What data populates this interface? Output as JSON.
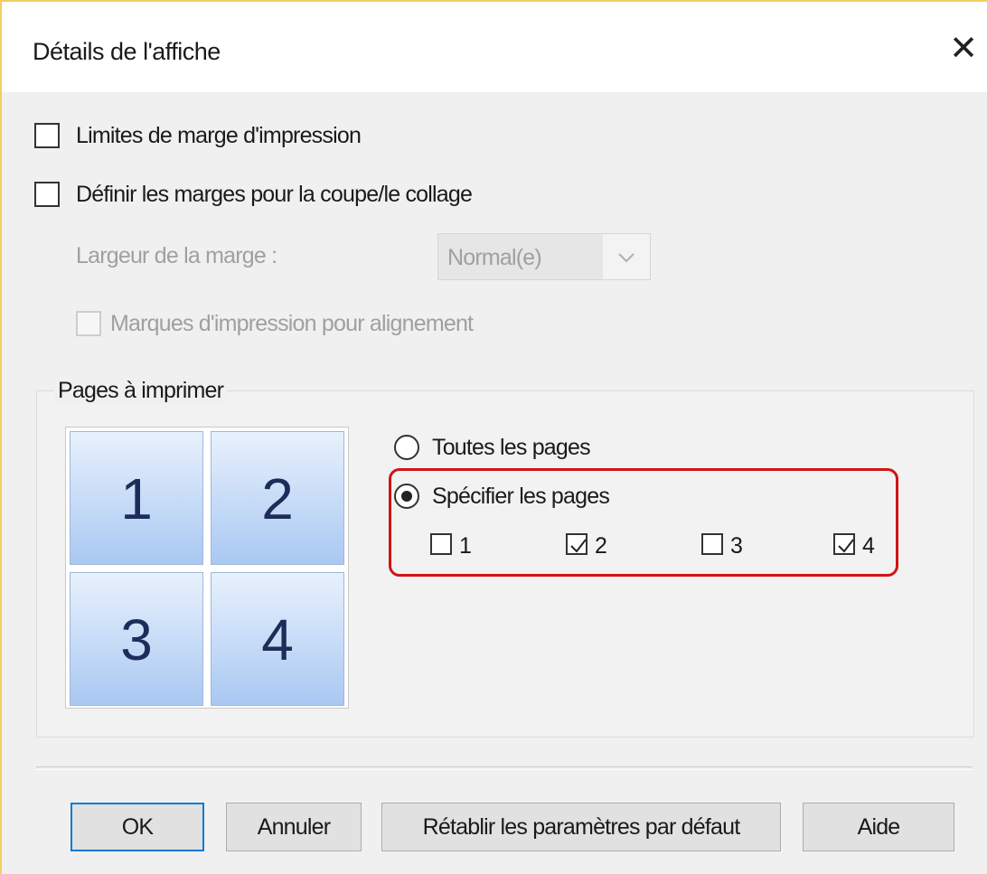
{
  "dialog": {
    "title": "Détails de l'affiche",
    "close_glyph": "✕"
  },
  "options": {
    "print_margin_limits": {
      "label": "Limites de marge d'impression",
      "checked": false
    },
    "set_cut_paste_margins": {
      "label": "Définir les marges pour la coupe/le collage",
      "checked": false
    },
    "margin_width": {
      "label": "Largeur de la marge :",
      "value": "Normal(e)",
      "enabled": false
    },
    "alignment_marks": {
      "label": "Marques d'impression pour alignement",
      "checked": false,
      "enabled": false
    }
  },
  "pages_group": {
    "title": "Pages à imprimer",
    "tiles": [
      "1",
      "2",
      "3",
      "4"
    ],
    "all_pages_label": "Toutes les pages",
    "specify_pages_label": "Spécifier les pages",
    "selected_mode": "specify",
    "page_checkboxes": [
      {
        "label": "1",
        "checked": false
      },
      {
        "label": "2",
        "checked": true
      },
      {
        "label": "3",
        "checked": false
      },
      {
        "label": "4",
        "checked": true
      }
    ]
  },
  "buttons": {
    "ok": "OK",
    "cancel": "Annuler",
    "reset": "Rétablir les paramètres par défaut",
    "help": "Aide"
  },
  "colors": {
    "highlight": "#d11414",
    "default_button_border": "#0a78d7",
    "tile_gradient_top": "#e8f1fd",
    "tile_gradient_bottom": "#a9c8f2"
  }
}
